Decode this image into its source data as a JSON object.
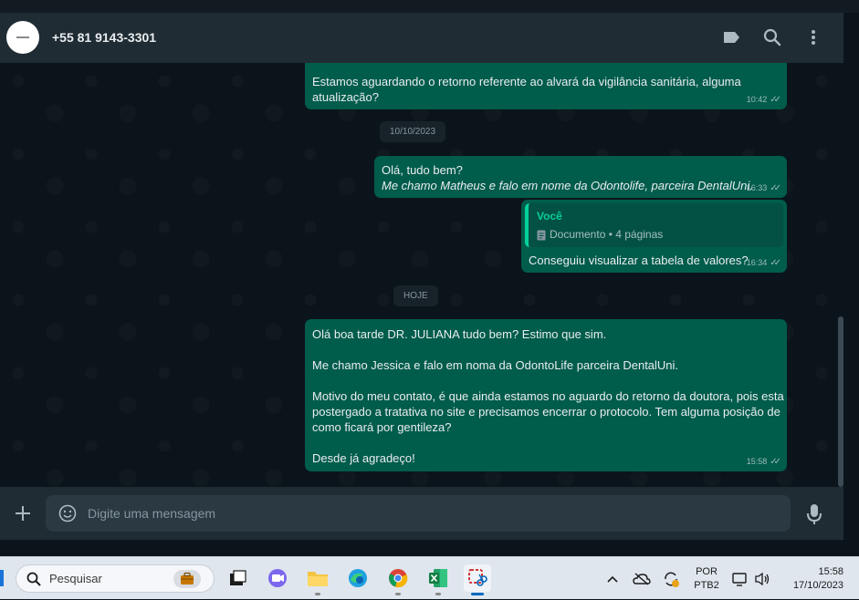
{
  "header": {
    "contact_name": "+55 81 9143-3301",
    "icons": [
      "label-icon",
      "search-icon",
      "menu-icon"
    ]
  },
  "messages": [
    {
      "text_line1": "Estamos aguardando o retorno referente ao alvará da vigilância sanitária, alguma",
      "text_line2": "atualização?",
      "time": "10:42"
    },
    {
      "line1": "Olá, tudo bem?",
      "line2": "Me chamo Matheus e falo em nome da Odontolife, parceira DentalUni.",
      "time": "16:33"
    },
    {
      "quote_author": "Você",
      "quote_doc": "Documento • 4 páginas",
      "text": "Conseguiu visualizar a tabela de valores?",
      "time": "16:34"
    },
    {
      "p1": "Olá boa tarde DR. JULIANA tudo bem? Estimo que sim.",
      "p2": "Me chamo Jessica e falo em noma da OdontoLife parceira DentalUni.",
      "p3_l1": "Motivo do meu contato, é que ainda estamos no aguardo do retorno da doutora, pois esta",
      "p3_l2": "postergado a tratativa no site e precisamos encerrar o protocolo. Tem alguma posição de",
      "p3_l3": "como ficará por gentileza?",
      "p4": "Desde já agradeço!",
      "time": "15:58"
    }
  ],
  "date_chips": {
    "first": "10/10/2023",
    "second": "HOJE"
  },
  "composer": {
    "placeholder": "Digite uma mensagem"
  },
  "taskbar": {
    "search_placeholder": "Pesquisar",
    "lang_line1": "POR",
    "lang_line2": "PTB2",
    "time": "15:58",
    "date": "17/10/2023"
  },
  "colors": {
    "outgoing_bubble": "#005c4b",
    "chat_bg": "#0b141a",
    "header_bg": "#202c33",
    "accent": "#06cf9c"
  }
}
